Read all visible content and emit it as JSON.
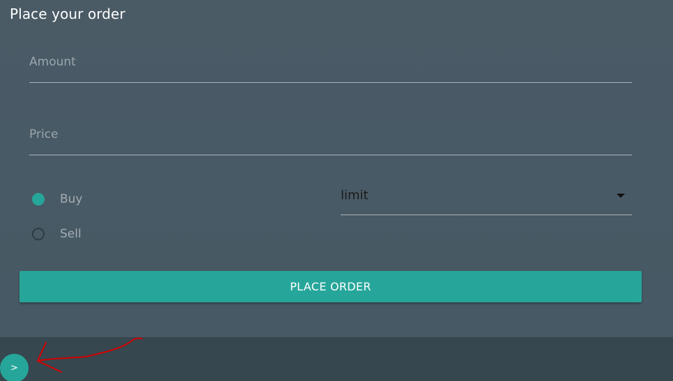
{
  "title": "Place your order",
  "fields": {
    "amount_placeholder": "Amount",
    "price_placeholder": "Price"
  },
  "side": {
    "options": [
      {
        "label": "Buy",
        "checked": true
      },
      {
        "label": "Sell",
        "checked": false
      }
    ]
  },
  "order_type": {
    "selected": "limit"
  },
  "place_order_label": "PLACE ORDER",
  "fab_label": ">",
  "colors": {
    "panel": "#4a5b66",
    "bottom_bar": "#37474f",
    "accent": "#26a69a",
    "annotation": "#d40000"
  }
}
